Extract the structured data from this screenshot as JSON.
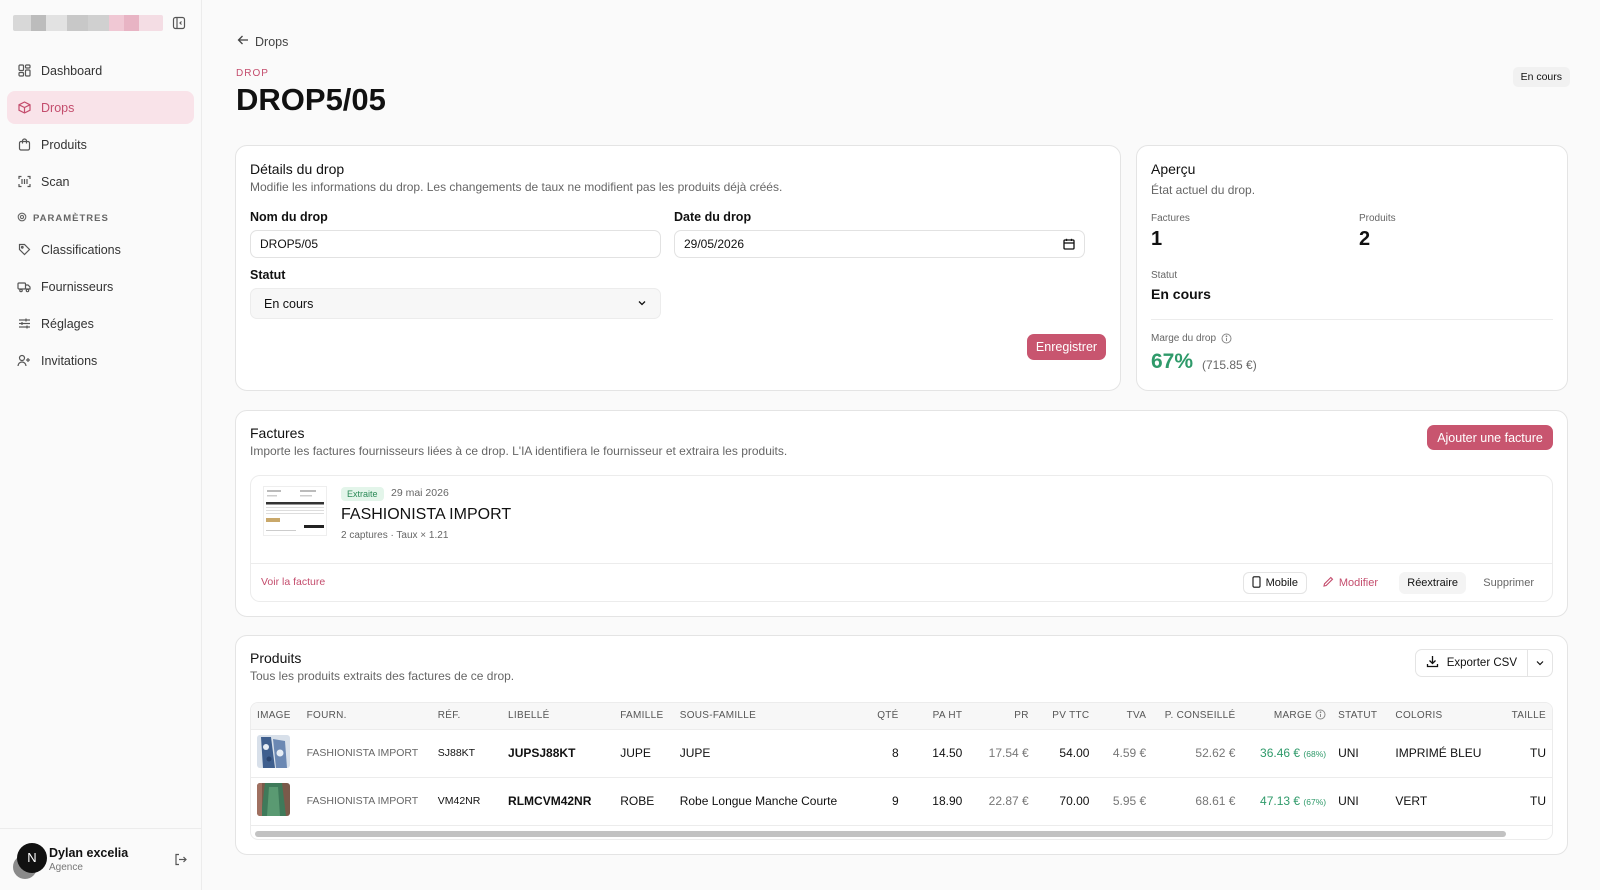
{
  "sidebar": {
    "nav": [
      {
        "label": "Dashboard",
        "icon": "dashboard-icon"
      },
      {
        "label": "Drops",
        "icon": "box-icon",
        "active": true
      },
      {
        "label": "Produits",
        "icon": "shopping-bag-icon"
      },
      {
        "label": "Scan",
        "icon": "scan-icon"
      }
    ],
    "section_label": "PARAMÈTRES",
    "settings": [
      {
        "label": "Classifications",
        "icon": "tag-icon"
      },
      {
        "label": "Fournisseurs",
        "icon": "truck-icon"
      },
      {
        "label": "Réglages",
        "icon": "sliders-icon"
      },
      {
        "label": "Invitations",
        "icon": "user-plus-icon"
      }
    ],
    "user": {
      "initial": "N",
      "name": "Dylan excelia",
      "role": "Agence"
    }
  },
  "header": {
    "back_label": "Drops",
    "kicker": "DROP",
    "title": "DROP5/05",
    "status_badge": "En cours"
  },
  "details": {
    "title": "Détails du drop",
    "description": "Modifie les informations du drop. Les changements de taux ne modifient pas les produits déjà créés.",
    "name_label": "Nom du drop",
    "name_value": "DROP5/05",
    "date_label": "Date du drop",
    "date_value": "29/05/2026",
    "status_label": "Statut",
    "status_value": "En cours",
    "save_label": "Enregistrer"
  },
  "apercu": {
    "title": "Aperçu",
    "description": "État actuel du drop.",
    "factures_label": "Factures",
    "factures_value": "1",
    "produits_label": "Produits",
    "produits_value": "2",
    "statut_label": "Statut",
    "statut_value": "En cours",
    "marge_label": "Marge du drop",
    "marge_percent": "67%",
    "marge_amount": "(715.85 €)"
  },
  "factures": {
    "title": "Factures",
    "description": "Importe les factures fournisseurs liées à ce drop. L'IA identifiera le fournisseur et extraira les produits.",
    "add_label": "Ajouter une facture",
    "invoice": {
      "badge": "Extraite",
      "date": "29 mai 2026",
      "supplier": "FASHIONISTA IMPORT",
      "meta": "2 captures · Taux × 1.21",
      "view_label": "Voir la facture",
      "mobile_label": "Mobile",
      "edit_label": "Modifier",
      "reextract_label": "Réextraire",
      "delete_label": "Supprimer"
    }
  },
  "produits": {
    "title": "Produits",
    "description": "Tous les produits extraits des factures de ce drop.",
    "export_label": "Exporter CSV",
    "columns": [
      "IMAGE",
      "FOURN.",
      "RÉF.",
      "LIBELLÉ",
      "FAMILLE",
      "SOUS-FAMILLE",
      "QTÉ",
      "PA HT",
      "PR",
      "PV TTC",
      "TVA",
      "P. CONSEILLÉ",
      "MARGE",
      "STATUT",
      "COLORIS",
      "TAILLE"
    ],
    "rows": [
      {
        "fourn": "FASHIONISTA IMPORT",
        "ref": "SJ88KT",
        "libelle": "JUPSJ88KT",
        "famille": "JUPE",
        "sous_famille": "JUPE",
        "qte": "8",
        "pa_ht": "14.50",
        "pr": "17.54 €",
        "pv_ttc": "54.00",
        "tva": "4.59 €",
        "p_conseille": "52.62 €",
        "marge": "36.46 €",
        "marge_pct": "(68%)",
        "statut": "UNI",
        "coloris": "IMPRIMÉ BLEU",
        "taille": "TU"
      },
      {
        "fourn": "FASHIONISTA IMPORT",
        "ref": "VM42NR",
        "libelle": "RLMCVM42NR",
        "famille": "ROBE",
        "sous_famille": "Robe Longue Manche Courte",
        "qte": "9",
        "pa_ht": "18.90",
        "pr": "22.87 €",
        "pv_ttc": "70.00",
        "tva": "5.95 €",
        "p_conseille": "68.61 €",
        "marge": "47.13 €",
        "marge_pct": "(67%)",
        "statut": "UNI",
        "coloris": "VERT",
        "taille": "TU"
      }
    ]
  },
  "colors": {
    "accent": "#c8556f",
    "accent_soft": "#f9e3e9",
    "positive": "#2f9a6a"
  }
}
